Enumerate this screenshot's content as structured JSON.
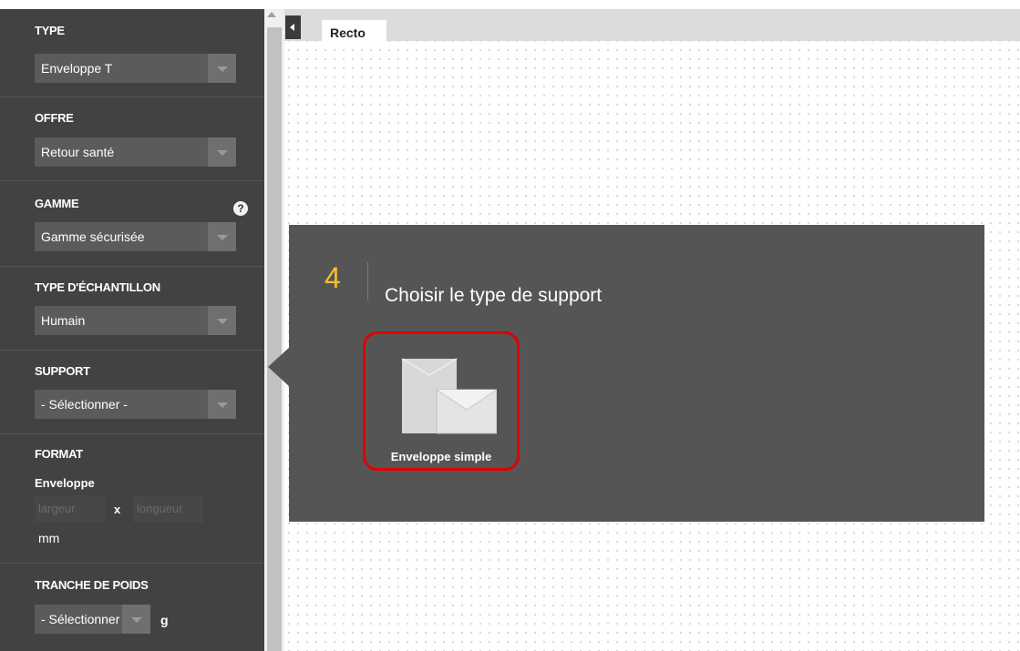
{
  "sidebar": {
    "type": {
      "title": "TYPE",
      "value": "Enveloppe T"
    },
    "offre": {
      "title": "OFFRE",
      "value": "Retour santé"
    },
    "gamme": {
      "title": "GAMME",
      "value": "Gamme sécurisée",
      "help": "?"
    },
    "echantillon": {
      "title": "TYPE D'ÉCHANTILLON",
      "value": "Humain"
    },
    "support": {
      "title": "SUPPORT",
      "value": "- Sélectionner -"
    },
    "format": {
      "title": "FORMAT",
      "subtitle": "Enveloppe",
      "width_placeholder": "largeur",
      "times": "x",
      "length_placeholder": "longueur",
      "unit": "mm"
    },
    "poids": {
      "title": "TRANCHE DE POIDS",
      "value": "- Sélectionner -",
      "unit": "g"
    }
  },
  "tabs": {
    "active": "Recto"
  },
  "step": {
    "number": "4",
    "title": "Choisir le type de support",
    "options": [
      {
        "label": "Enveloppe simple",
        "icon": "envelope-icon"
      }
    ]
  },
  "colors": {
    "accent": "#f2c22b",
    "highlight": "#e00000",
    "panel": "#555555",
    "sidebar": "#424242"
  }
}
